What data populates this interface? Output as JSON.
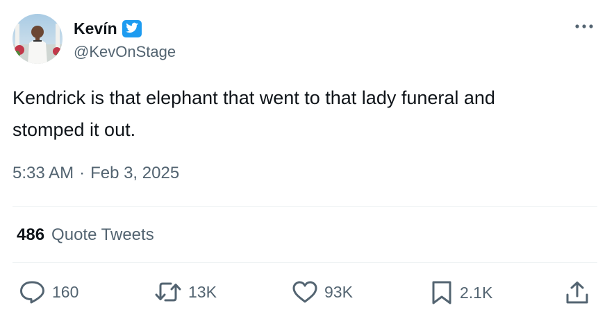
{
  "author": {
    "name": "Kevín",
    "handle": "@KevOnStage",
    "verified": true,
    "verified_color": "#1d9bf0"
  },
  "menu": {
    "icon": "more-horizontal-icon"
  },
  "tweet": {
    "text_line1": "Kendrick is that elephant that went to that lady funeral and",
    "text_line2": "stomped it out.",
    "time": "5:33 AM",
    "separator": "·",
    "date": "Feb 3, 2025"
  },
  "stats": {
    "quote_count": "486",
    "quote_label": "Quote Tweets"
  },
  "actions": {
    "reply": {
      "icon": "reply-icon",
      "count": "160"
    },
    "retweet": {
      "icon": "retweet-icon",
      "count": "13K"
    },
    "like": {
      "icon": "heart-icon",
      "count": "93K"
    },
    "bookmark": {
      "icon": "bookmark-icon",
      "count": "2.1K"
    },
    "share": {
      "icon": "share-icon"
    }
  },
  "colors": {
    "text_primary": "#0f1419",
    "text_secondary": "#536471",
    "divider": "#eff3f4"
  }
}
